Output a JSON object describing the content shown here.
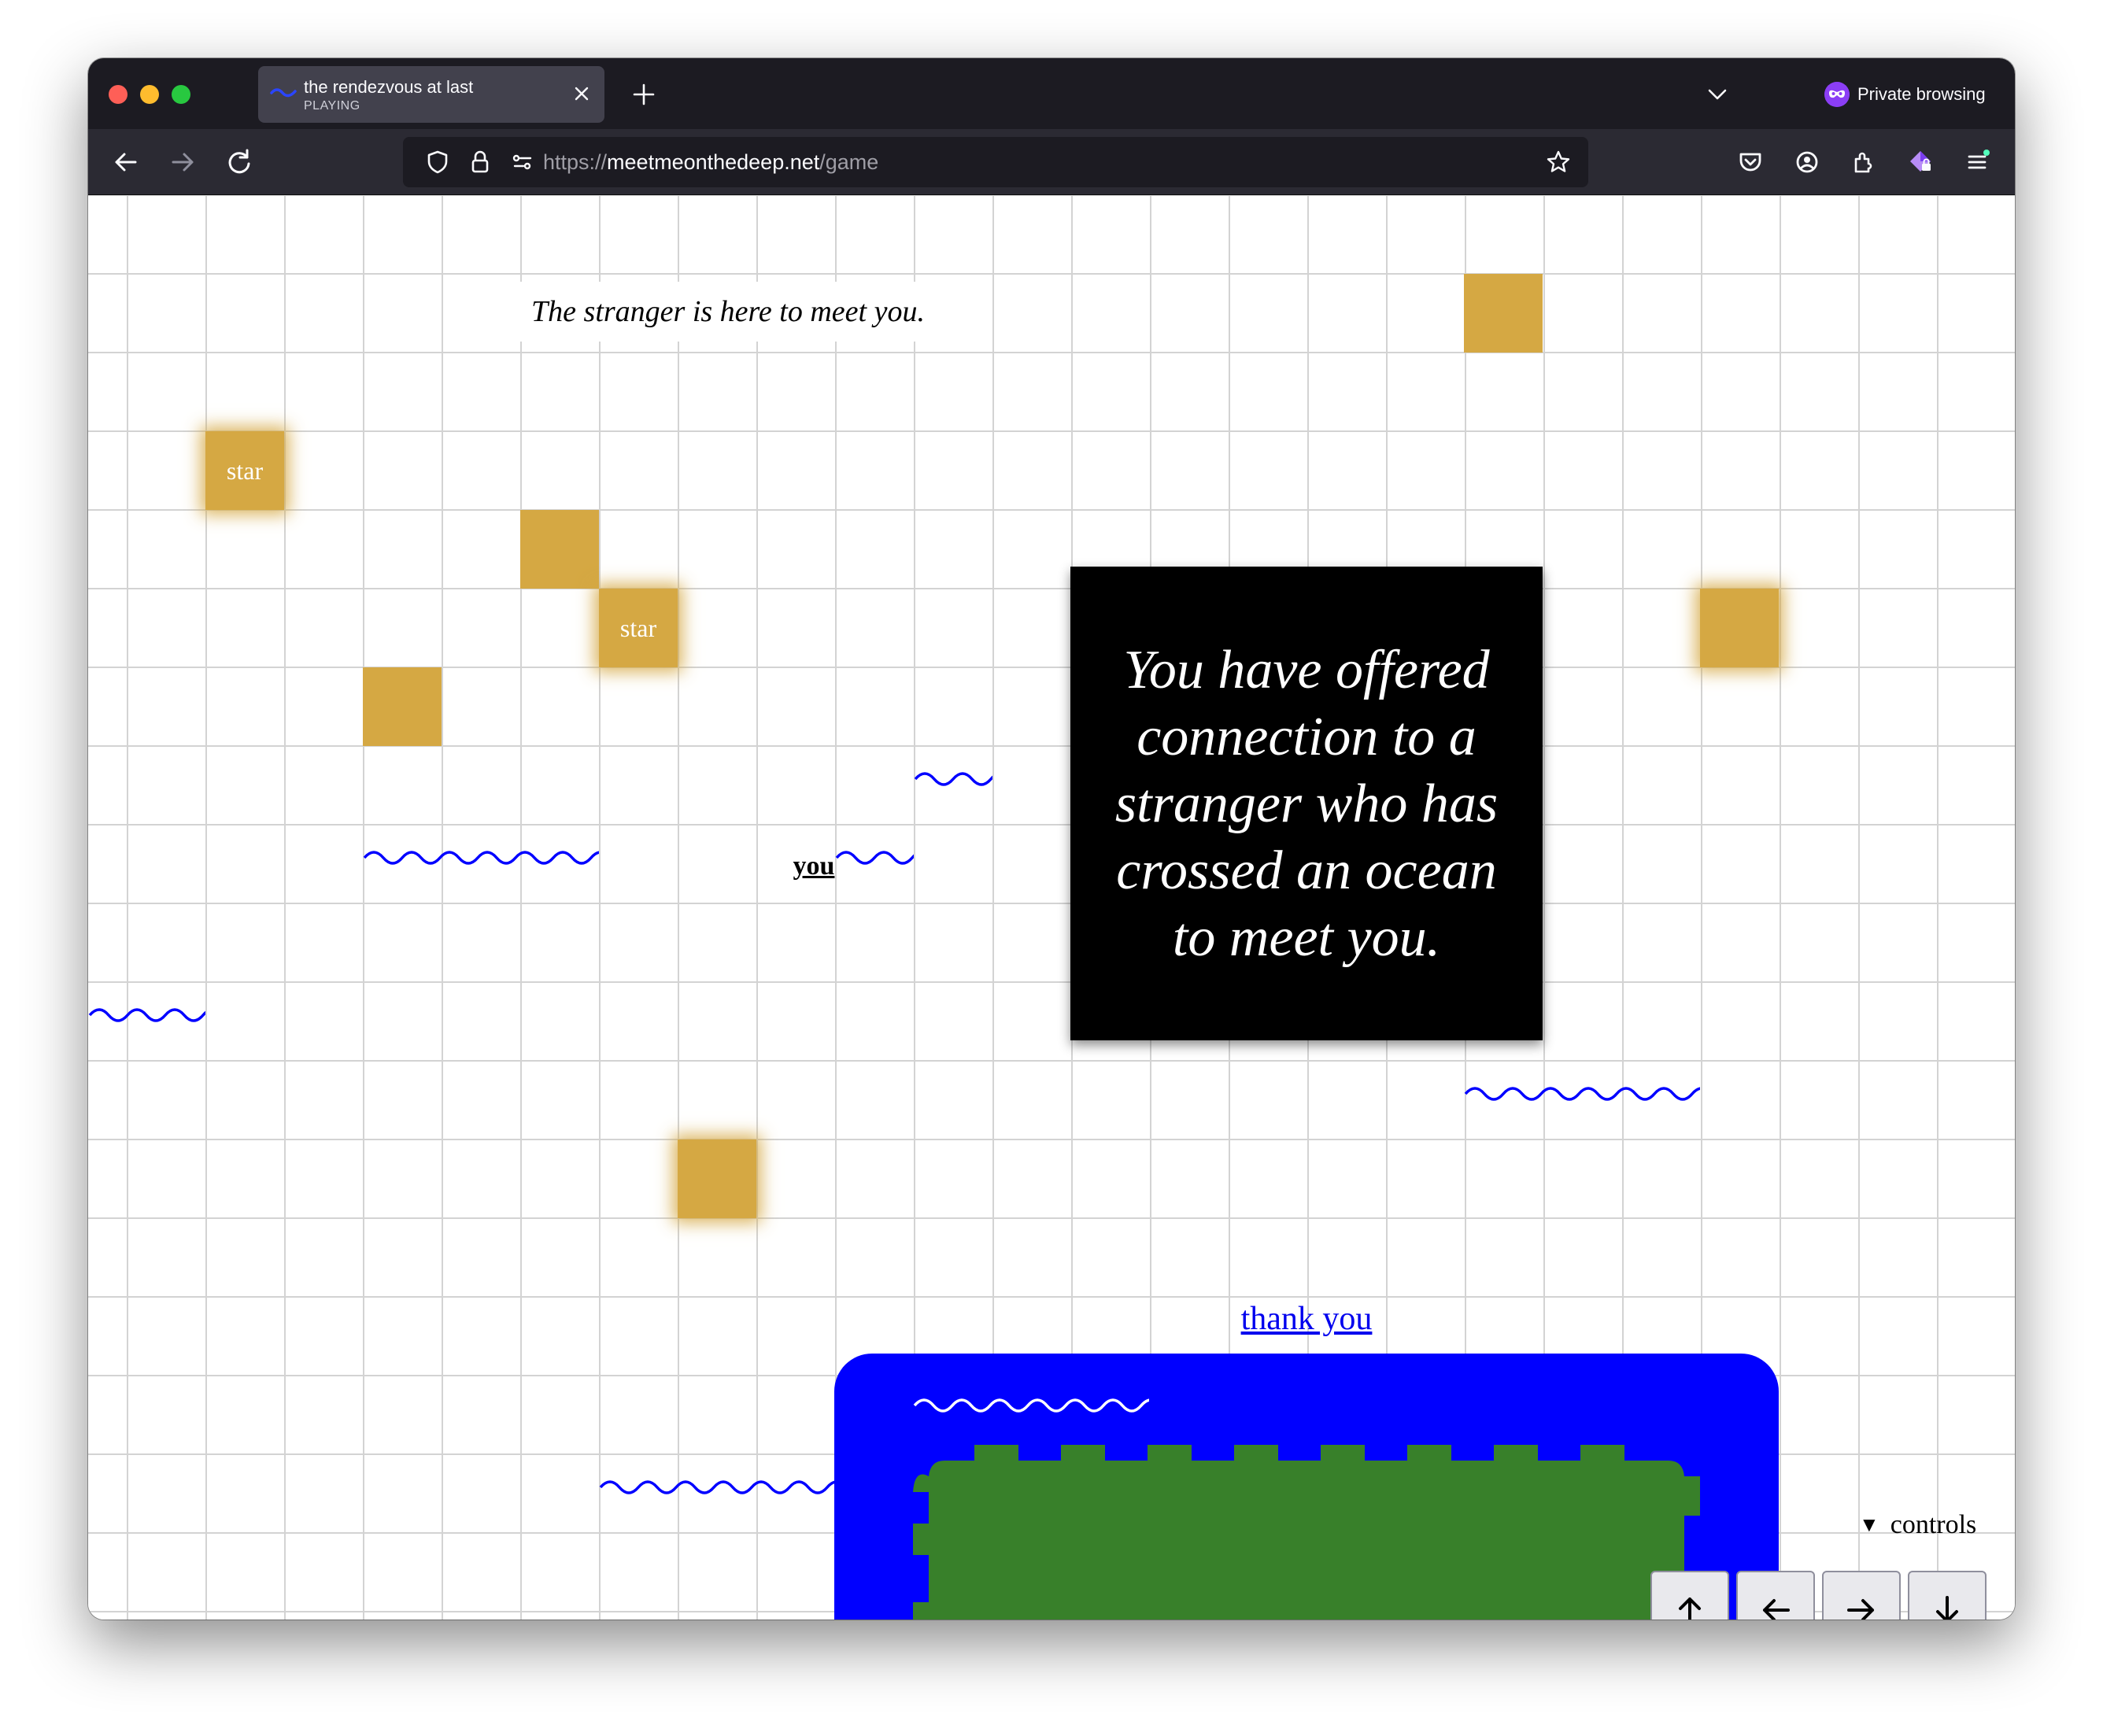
{
  "browser": {
    "tab": {
      "title": "the rendezvous at last",
      "status": "PLAYING"
    },
    "private_label": "Private browsing",
    "url": {
      "scheme": "https://",
      "host": "meetmeonthedeep.net",
      "path": "/game"
    }
  },
  "game": {
    "stranger_message": "The stranger is here to meet you.",
    "star_label": "star",
    "player_label": "you",
    "dialog_text": "You have offered connection to a stranger who has crossed an ocean to meet you.",
    "thank_you_link": "thank you",
    "controls": {
      "summary": "controls",
      "buttons": [
        {
          "label": "↑",
          "icon": "arrow-up-icon"
        },
        {
          "label": "←",
          "icon": "arrow-left-icon"
        },
        {
          "label": "→",
          "icon": "arrow-right-icon"
        },
        {
          "label": "↓",
          "icon": "arrow-down-icon"
        }
      ]
    },
    "colors": {
      "star": "#d5a843",
      "water": "#0000ff",
      "land": "#38802a",
      "wave": "#0000ff"
    }
  }
}
